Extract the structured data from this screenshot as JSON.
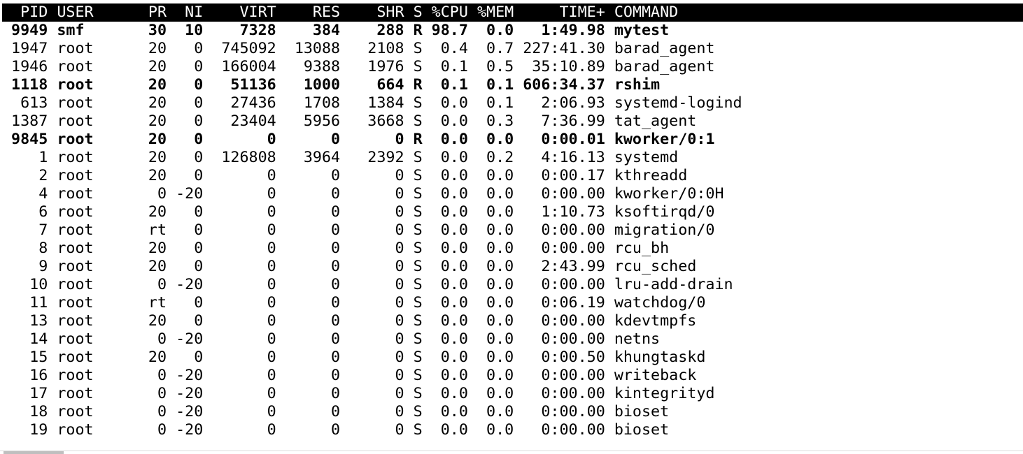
{
  "header_line": "  PID USER      PR  NI    VIRT    RES    SHR S %CPU %MEM     TIME+ COMMAND",
  "processes": [
    {
      "line": " 9949 smf       30  10    7328    384    288 R 98.7  0.0   1:49.98 mytest",
      "bold": true
    },
    {
      "line": " 1947 root      20   0  745092  13088   2108 S  0.4  0.7 227:41.30 barad_agent",
      "bold": false
    },
    {
      "line": " 1946 root      20   0  166004   9388   1976 S  0.1  0.5  35:10.89 barad_agent",
      "bold": false
    },
    {
      "line": " 1118 root      20   0   51136   1000    664 R  0.1  0.1 606:34.37 rshim",
      "bold": true
    },
    {
      "line": "  613 root      20   0   27436   1708   1384 S  0.0  0.1   2:06.93 systemd-logind",
      "bold": false
    },
    {
      "line": " 1387 root      20   0   23404   5956   3668 S  0.0  0.3   7:36.99 tat_agent",
      "bold": false
    },
    {
      "line": " 9845 root      20   0       0      0      0 R  0.0  0.0   0:00.01 kworker/0:1",
      "bold": true
    },
    {
      "line": "    1 root      20   0  126808   3964   2392 S  0.0  0.2   4:16.13 systemd",
      "bold": false
    },
    {
      "line": "    2 root      20   0       0      0      0 S  0.0  0.0   0:00.17 kthreadd",
      "bold": false
    },
    {
      "line": "    4 root       0 -20       0      0      0 S  0.0  0.0   0:00.00 kworker/0:0H",
      "bold": false
    },
    {
      "line": "    6 root      20   0       0      0      0 S  0.0  0.0   1:10.73 ksoftirqd/0",
      "bold": false
    },
    {
      "line": "    7 root      rt   0       0      0      0 S  0.0  0.0   0:00.00 migration/0",
      "bold": false
    },
    {
      "line": "    8 root      20   0       0      0      0 S  0.0  0.0   0:00.00 rcu_bh",
      "bold": false
    },
    {
      "line": "    9 root      20   0       0      0      0 S  0.0  0.0   2:43.99 rcu_sched",
      "bold": false
    },
    {
      "line": "   10 root       0 -20       0      0      0 S  0.0  0.0   0:00.00 lru-add-drain",
      "bold": false
    },
    {
      "line": "   11 root      rt   0       0      0      0 S  0.0  0.0   0:06.19 watchdog/0",
      "bold": false
    },
    {
      "line": "   13 root      20   0       0      0      0 S  0.0  0.0   0:00.00 kdevtmpfs",
      "bold": false
    },
    {
      "line": "   14 root       0 -20       0      0      0 S  0.0  0.0   0:00.00 netns",
      "bold": false
    },
    {
      "line": "   15 root      20   0       0      0      0 S  0.0  0.0   0:00.50 khungtaskd",
      "bold": false
    },
    {
      "line": "   16 root       0 -20       0      0      0 S  0.0  0.0   0:00.00 writeback",
      "bold": false
    },
    {
      "line": "   17 root       0 -20       0      0      0 S  0.0  0.0   0:00.00 kintegrityd",
      "bold": false
    },
    {
      "line": "   18 root       0 -20       0      0      0 S  0.0  0.0   0:00.00 bioset",
      "bold": false
    },
    {
      "line": "   19 root       0 -20       0      0      0 S  0.0  0.0   0:00.00 bioset",
      "bold": false
    }
  ]
}
